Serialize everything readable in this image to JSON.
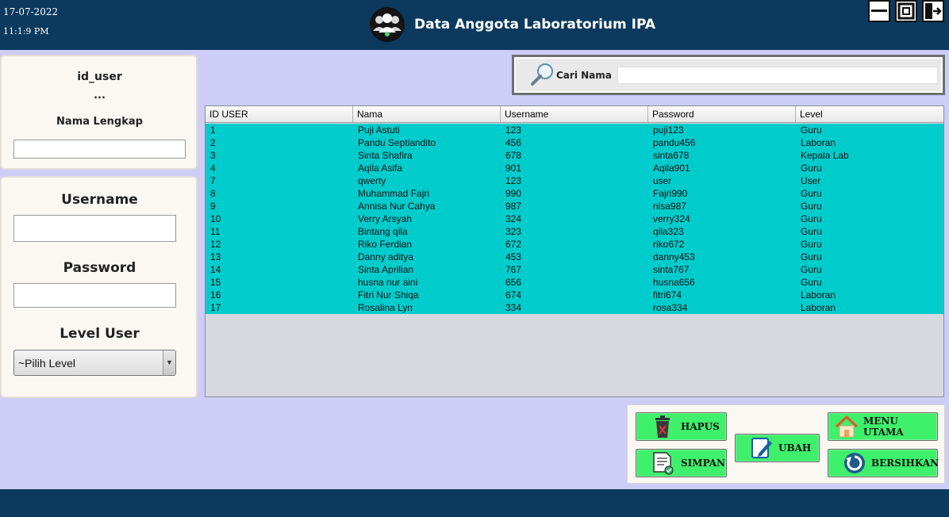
{
  "header": {
    "date": "17-07-2022",
    "time": "11:1:9 PM",
    "title": "Data Anggota Laboratorium IPA"
  },
  "form": {
    "id_label": "id_user",
    "id_value": "...",
    "fullname_label": "Nama Lengkap",
    "fullname_value": "",
    "username_label": "Username",
    "username_value": "",
    "password_label": "Password",
    "password_value": "",
    "level_label": "Level User",
    "level_selected": "~Pilih Level"
  },
  "search": {
    "label": "Cari Nama",
    "value": ""
  },
  "table": {
    "columns": [
      "ID USER",
      "Nama",
      "Username",
      "Password",
      "Level"
    ],
    "rows": [
      [
        "1",
        "Puji Astuti",
        "123",
        "puji123",
        "Guru"
      ],
      [
        "2",
        "Pandu Septiandito",
        "456",
        "pandu456",
        "Laboran"
      ],
      [
        "3",
        "Sinta Shafira",
        "678",
        "sinta678",
        "Kepala Lab"
      ],
      [
        "4",
        "Aqila Asifa",
        "901",
        "Aqila901",
        "Guru"
      ],
      [
        "7",
        "qwerty",
        "123",
        "user",
        "User"
      ],
      [
        "8",
        "Muhammad Fajri",
        "990",
        "Fajri990",
        "Guru"
      ],
      [
        "9",
        "Annisa Nur Cahya",
        "987",
        "nisa987",
        "Guru"
      ],
      [
        "10",
        "Verry Arsyah",
        "324",
        "verry324",
        "Guru"
      ],
      [
        "11",
        "Bintang qila",
        "323",
        "qila323",
        "Guru"
      ],
      [
        "12",
        "Riko Ferdian",
        "672",
        "riko672",
        "Guru"
      ],
      [
        "13",
        "Danny aditya",
        "453",
        "danny453",
        "Guru"
      ],
      [
        "14",
        "Sinta Aprilian",
        "767",
        "sinta767",
        "Guru"
      ],
      [
        "15",
        "husna nur aini",
        "656",
        "husna656",
        "Guru"
      ],
      [
        "16",
        "Fitri Nur Shiqa",
        "674",
        "fitri674",
        "Laboran"
      ],
      [
        "17",
        "Rosalina Lyn",
        "334",
        "rosa334",
        "Laboran"
      ]
    ]
  },
  "buttons": {
    "hapus": "HAPUS",
    "simpan": "SIMPAN",
    "ubah": "UBAH",
    "menu_utama": "MENU UTAMA",
    "bersihkan": "BERSIHKAN"
  },
  "icons": {
    "minimize": "minimize-icon",
    "maximize": "maximize-icon",
    "logout": "logout-icon",
    "logo": "users-group-icon",
    "search": "magnifier-icon",
    "delete": "trash-icon",
    "save": "save-document-icon",
    "edit": "pencil-edit-icon",
    "home": "home-icon",
    "refresh": "refresh-icon"
  },
  "colors": {
    "header_bg": "#0c3a5e",
    "page_bg": "#cdcdf8",
    "row_bg": "#00cccc",
    "button_bg": "#3ff06b"
  }
}
